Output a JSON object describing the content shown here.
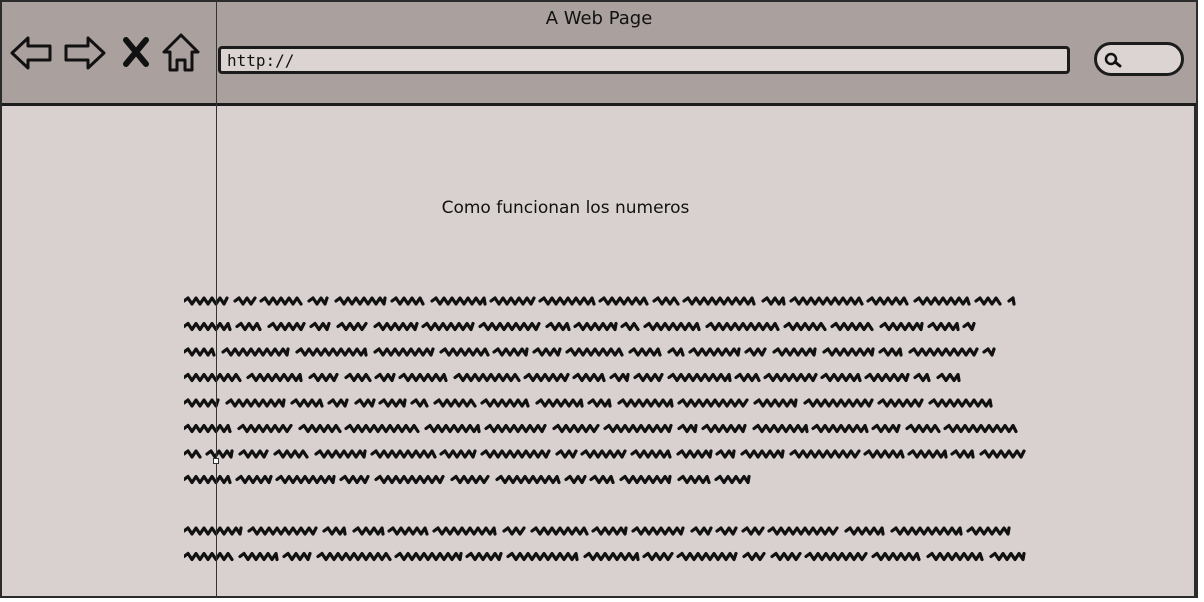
{
  "window": {
    "title": "A Web Page"
  },
  "toolbar": {
    "back_icon": "arrow-left-icon",
    "forward_icon": "arrow-right-icon",
    "stop_icon": "close-icon",
    "home_icon": "home-icon",
    "address_value": "http://",
    "search_icon": "search-icon"
  },
  "page": {
    "heading": "Como funcionan los numeros",
    "paragraphs": [
      {
        "line_count": 8
      },
      {
        "line_count": 2
      }
    ]
  },
  "colors": {
    "toolbar_bg": "#aaa19f",
    "page_bg": "#d9d1cf",
    "ink": "#111111"
  }
}
